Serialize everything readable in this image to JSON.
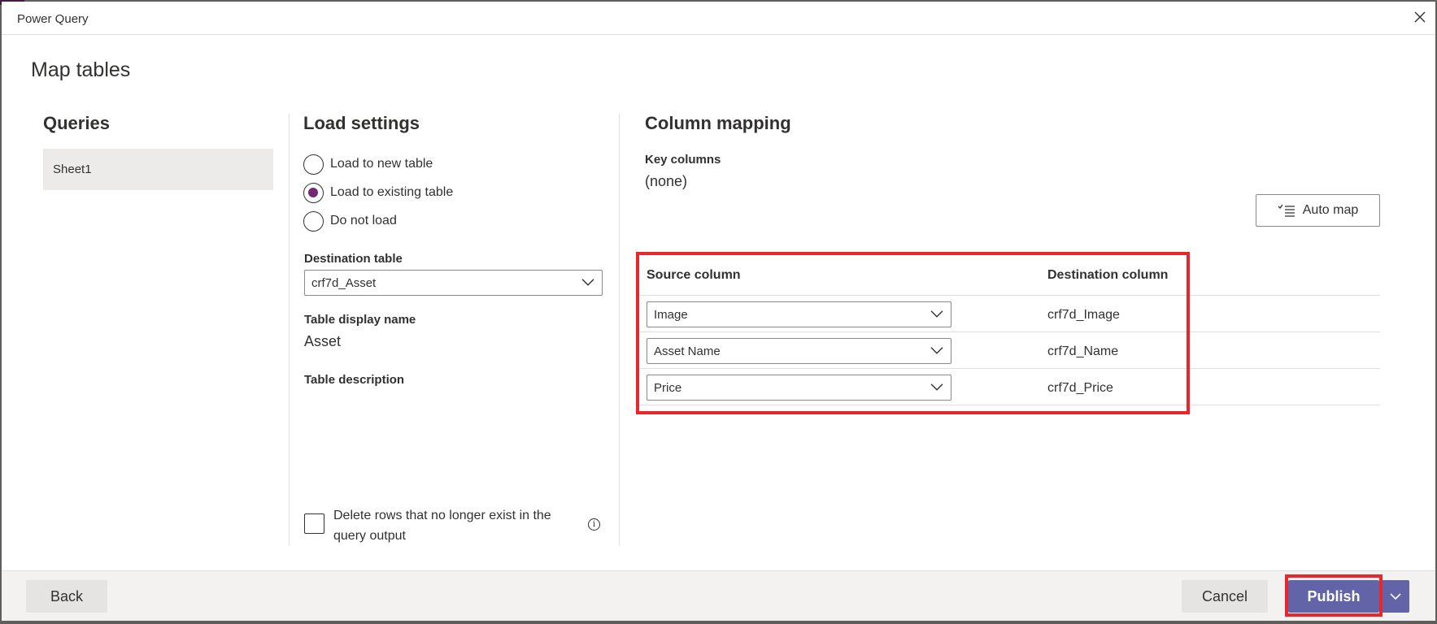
{
  "window": {
    "title": "Power Query",
    "close_icon": "close-icon"
  },
  "page": {
    "title": "Map tables"
  },
  "queries": {
    "heading": "Queries",
    "items": [
      "Sheet1"
    ]
  },
  "load_settings": {
    "heading": "Load settings",
    "options": [
      {
        "label": "Load to new table",
        "selected": false
      },
      {
        "label": "Load to existing table",
        "selected": true
      },
      {
        "label": "Do not load",
        "selected": false
      }
    ],
    "destination_table_label": "Destination table",
    "destination_table_value": "crf7d_Asset",
    "display_name_label": "Table display name",
    "display_name_value": "Asset",
    "description_label": "Table description",
    "delete_rows_label": "Delete rows that no longer exist in the query output",
    "delete_rows_checked": false,
    "info_icon": "info-icon"
  },
  "column_mapping": {
    "heading": "Column mapping",
    "key_columns_label": "Key columns",
    "key_columns_value": "(none)",
    "auto_map_label": "Auto map",
    "auto_map_icon": "checklist-icon",
    "source_header": "Source column",
    "destination_header": "Destination column",
    "rows": [
      {
        "source": "Image",
        "destination": "crf7d_Image"
      },
      {
        "source": "Asset Name",
        "destination": "crf7d_Name"
      },
      {
        "source": "Price",
        "destination": "crf7d_Price"
      }
    ]
  },
  "footer": {
    "back_label": "Back",
    "cancel_label": "Cancel",
    "publish_label": "Publish",
    "publish_menu_icon": "chevron-down-icon"
  },
  "colors": {
    "accent": "#742774",
    "primary_button": "#6264a7",
    "highlight": "#e8262b"
  }
}
